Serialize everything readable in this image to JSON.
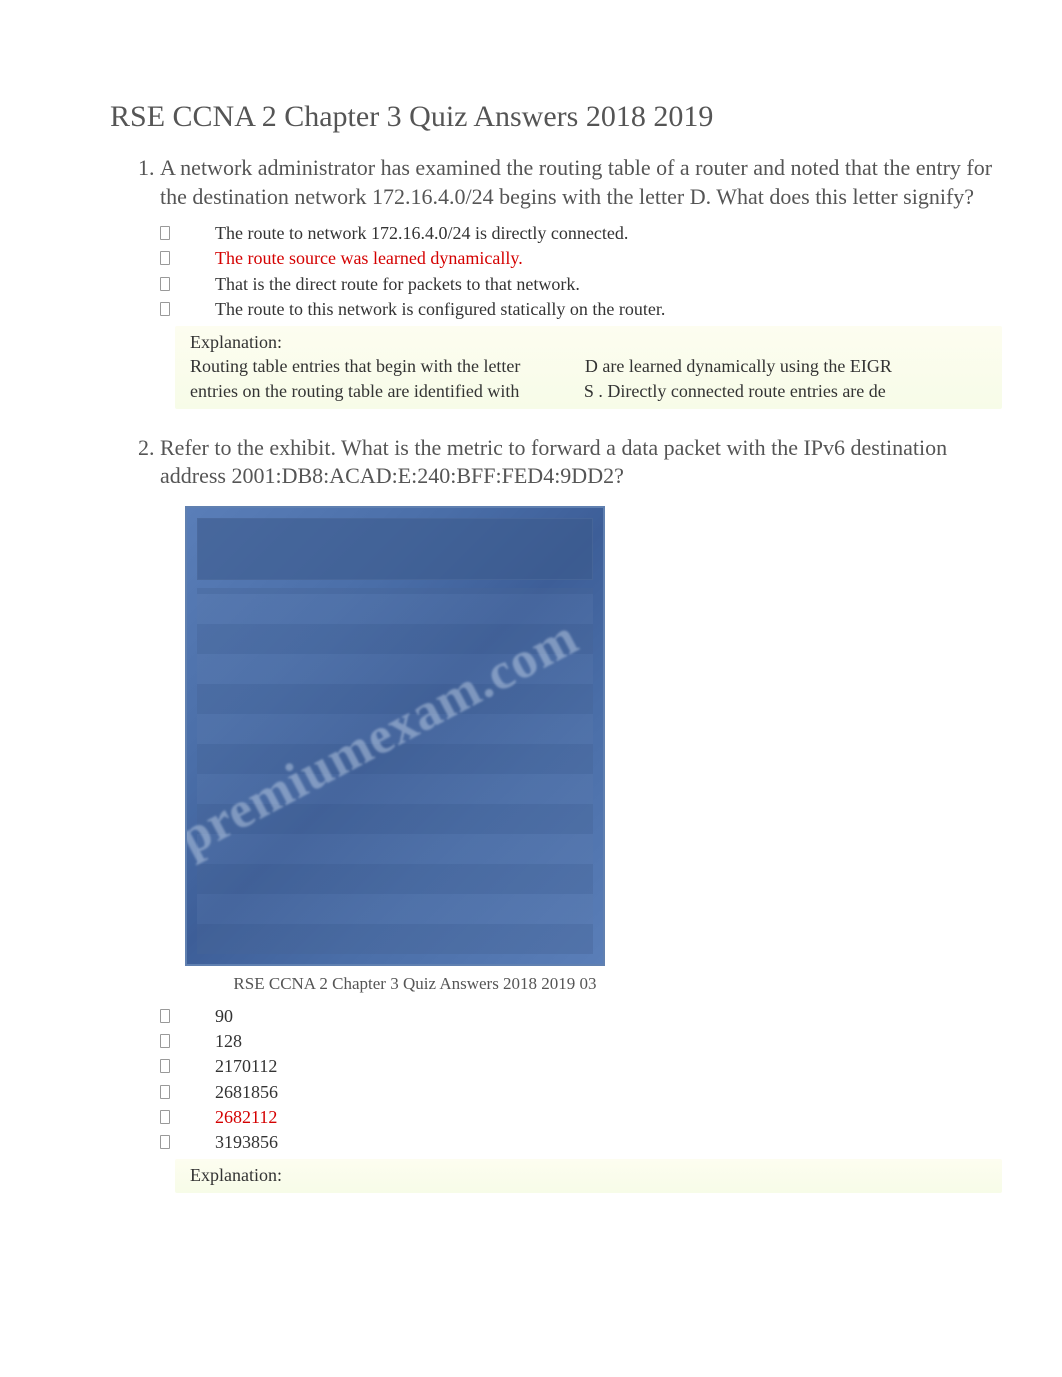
{
  "title": "RSE CCNA 2 Chapter 3 Quiz Answers 2018 2019",
  "questions": [
    {
      "text": "A network administrator has examined the routing table of a router and noted that the entry for the destination network 172.16.4.0/24 begins with the letter D. What does this letter signify?",
      "options": [
        {
          "text": "The route to network 172.16.4.0/24 is directly connected.",
          "correct": false
        },
        {
          "text": "The route source was learned dynamically.",
          "correct": true
        },
        {
          "text": "That is the direct route for packets to that network.",
          "correct": false
        },
        {
          "text": "The route to this network is configured statically on the router.",
          "correct": false
        }
      ],
      "explanation": {
        "label": "Explanation:",
        "line1_part1": "Routing table entries that begin with the letter",
        "line1_d": "D",
        "line1_part2": " are learned dynamically using the EIGR",
        "line2_part1": "entries on the routing table are identified with",
        "line2_s": "S",
        "line2_part2": " . Directly connected route entries are de"
      }
    },
    {
      "text": "Refer to the exhibit. What is the metric to forward a data packet with the IPv6 destination address 2001:DB8:ACAD:E:240:BFF:FED4:9DD2?",
      "caption": "RSE CCNA 2 Chapter 3 Quiz Answers 2018 2019 03",
      "options": [
        {
          "text": "90",
          "correct": false
        },
        {
          "text": "128",
          "correct": false
        },
        {
          "text": "2170112",
          "correct": false
        },
        {
          "text": "2681856",
          "correct": false
        },
        {
          "text": "2682112",
          "correct": true
        },
        {
          "text": "3193856",
          "correct": false
        }
      ],
      "explanation": {
        "label": "Explanation:"
      }
    }
  ]
}
